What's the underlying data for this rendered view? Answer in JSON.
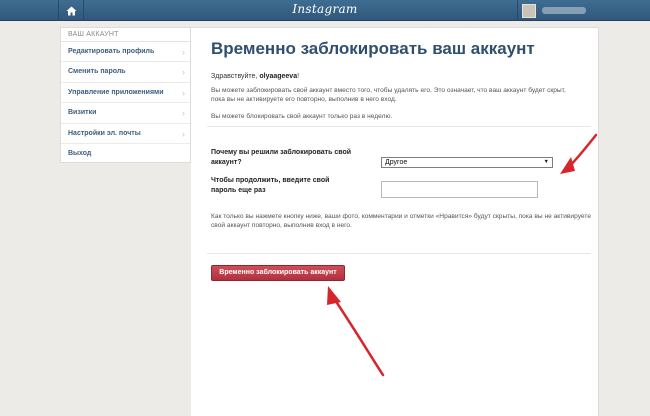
{
  "header": {
    "brand": "Instagram",
    "home_icon": "home-icon"
  },
  "sidebar": {
    "header": "ВАШ АККАУНТ",
    "items": [
      {
        "label": "Редактировать профиль"
      },
      {
        "label": "Сменить пароль"
      },
      {
        "label": "Управление приложениями"
      },
      {
        "label": "Визитки"
      },
      {
        "label": "Настройки эл. почты"
      },
      {
        "label": "Выход"
      }
    ]
  },
  "main": {
    "title": "Временно заблокировать ваш аккаунт",
    "greeting_prefix": "Здравствуйте, ",
    "username": "olyaageeva",
    "greeting_suffix": "!",
    "description": "Вы можете заблокировать свой аккаунт вместо того, чтобы удалять его. Это означает, что ваш аккаунт будет скрыт, пока вы не активируете его повторно, выполнив в него вход.",
    "weekly_note": "Вы можете блокировать свой аккаунт только раз в неделю.",
    "reason_label": "Почему вы решили заблокировать свой аккаунт?",
    "reason_selected": "Другое",
    "password_label": "Чтобы продолжить, введите свой пароль еще раз",
    "password_value": "",
    "warning": "Как только вы нажмете кнопку ниже, ваши фото, комментарии и отметки «Нравится» будут скрыты, пока вы не активируете свой аккаунт повторно, выполнив вход в него.",
    "deactivate_button": "Временно заблокировать аккаунт"
  },
  "colors": {
    "topbar": "#3f6d92",
    "title": "#2f4f6e",
    "button": "#c0404c",
    "annotation": "#d8252b"
  }
}
